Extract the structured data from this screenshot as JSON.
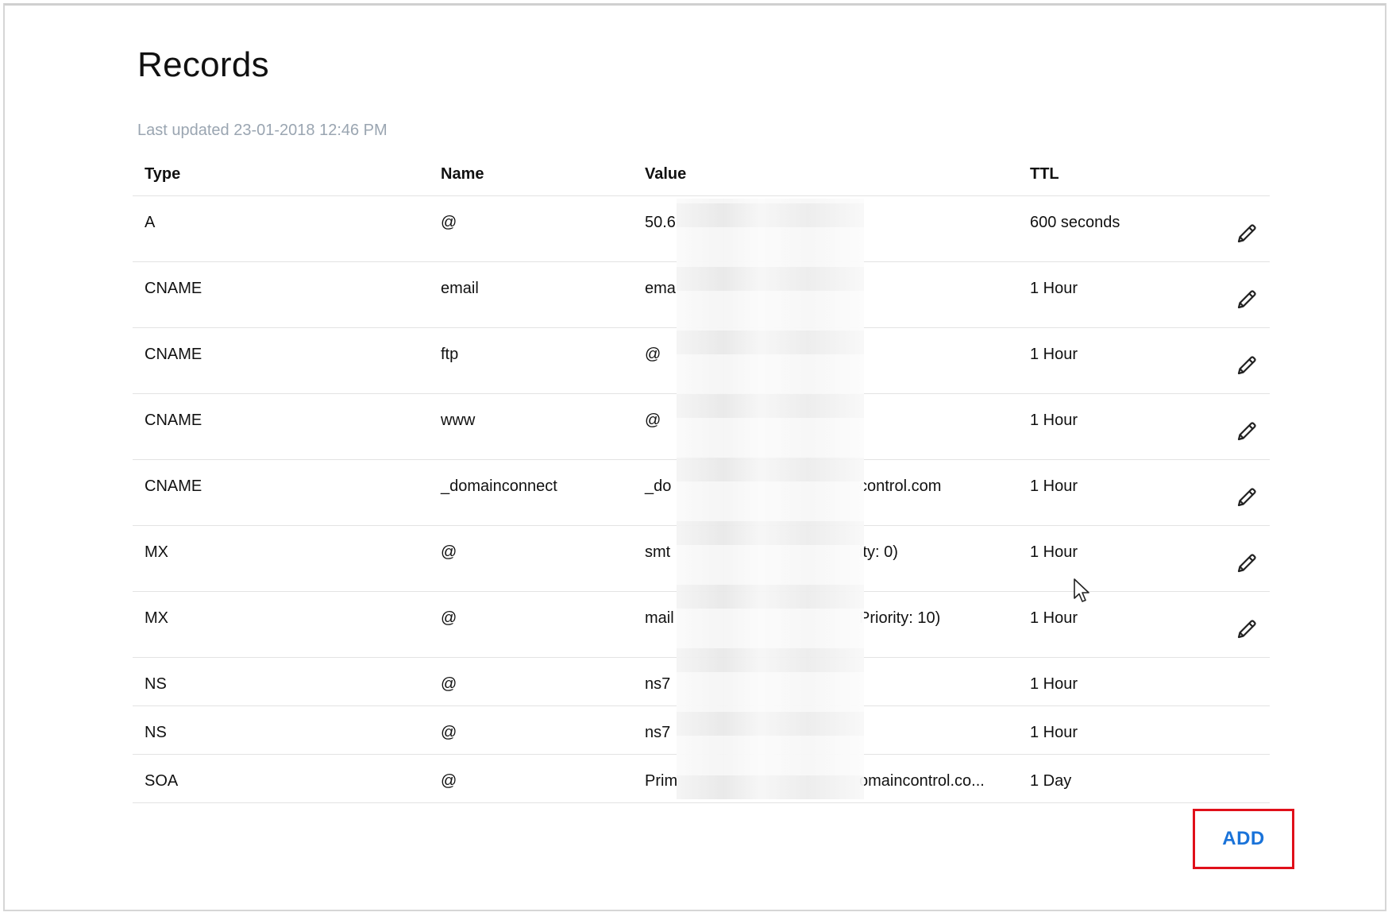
{
  "page": {
    "title": "Records",
    "last_updated": "Last updated 23-01-2018 12:46 PM"
  },
  "table": {
    "headers": {
      "type": "Type",
      "name": "Name",
      "value": "Value",
      "ttl": "TTL"
    },
    "rows": [
      {
        "type": "A",
        "name": "@",
        "value": "50.6",
        "ttl": "600 seconds",
        "editable": true
      },
      {
        "type": "CNAME",
        "name": "email",
        "value": "ema",
        "ttl": "1 Hour",
        "editable": true
      },
      {
        "type": "CNAME",
        "name": "ftp",
        "value": "@",
        "ttl": "1 Hour",
        "editable": true
      },
      {
        "type": "CNAME",
        "name": "www",
        "value": "@",
        "ttl": "1 Hour",
        "editable": true
      },
      {
        "type": "CNAME",
        "name": "_domainconnect",
        "value": "_do",
        "value_tail": "control.com",
        "ttl": "1 Hour",
        "editable": true
      },
      {
        "type": "MX",
        "name": "@",
        "value": "smt",
        "value_tail": "ity: 0)",
        "ttl": "1 Hour",
        "editable": true
      },
      {
        "type": "MX",
        "name": "@",
        "value": "mail",
        "value_tail": "Priority: 10)",
        "ttl": "1 Hour",
        "editable": true
      },
      {
        "type": "NS",
        "name": "@",
        "value": "ns7",
        "ttl": "1 Hour",
        "editable": false
      },
      {
        "type": "NS",
        "name": "@",
        "value": "ns7",
        "ttl": "1 Hour",
        "editable": false
      },
      {
        "type": "SOA",
        "name": "@",
        "value": "Prim",
        "value_tail": "omaincontrol.co...",
        "ttl": "1 Day",
        "editable": false
      }
    ]
  },
  "actions": {
    "add_label": "ADD"
  },
  "icons": {
    "edit": "pencil-icon",
    "cursor": "mouse-pointer-icon"
  },
  "colors": {
    "accent": "#1a73d9",
    "highlight": "#e0101a",
    "muted": "#9aa5b1"
  }
}
